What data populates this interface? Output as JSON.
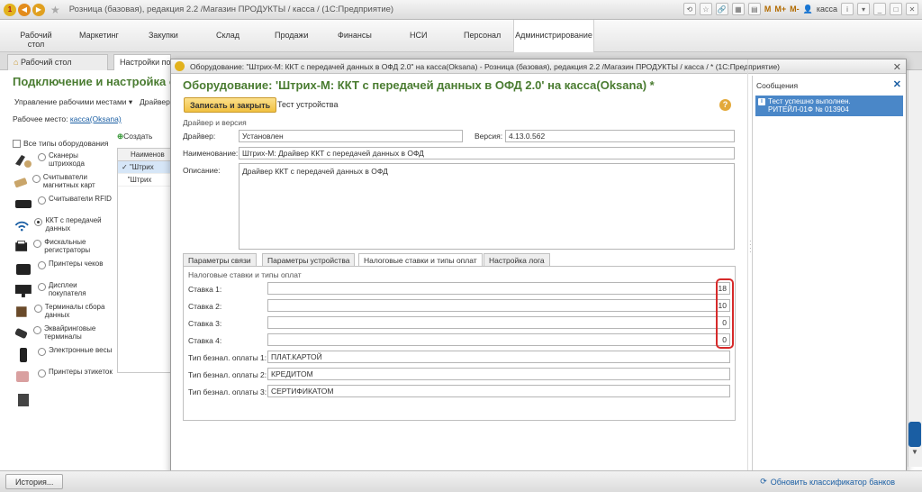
{
  "window": {
    "title": "Розница (базовая), редакция 2.2 /Магазин ПРОДУКТЫ / касса /  (1С:Предприятие)",
    "user": "касса",
    "m_buttons": [
      "M",
      "M+",
      "M-"
    ]
  },
  "sections": [
    "Рабочий стол",
    "Маркетинг",
    "Закупки",
    "Склад",
    "Продажи",
    "Финансы",
    "НСИ",
    "Персонал",
    "Администрирование"
  ],
  "tabs": [
    "Рабочий стол",
    "Настройки под"
  ],
  "page": {
    "title": "Подключение и настройка о",
    "subnav_left": "Управление рабочими местами",
    "subnav_right": "Драйвер",
    "workplace_label": "Рабочее место:",
    "workplace_value": "касса(Oksana)",
    "create_label": "Создать",
    "all_types_label": "Все типы оборудования",
    "device_types": [
      "Сканеры штрихкода",
      "Считыватели магнитных карт",
      "Считыватели RFID",
      "ККТ с передачей данных",
      "Фискальные регистраторы",
      "Принтеры чеков",
      "Дисплеи покупателя",
      "Терминалы сбора данных",
      "Эквайринговые терминалы",
      "Электронные весы",
      "Принтеры этикеток"
    ],
    "grid_header": "Наименов",
    "grid_rows": [
      "\"Штрих",
      "\"Штрих"
    ]
  },
  "modal": {
    "window_title": "Оборудование: \"Штрих-М: ККТ с передачей данных в ОФД 2.0\" на касса(Oksana) - Розница (базовая), редакция 2.2 /Магазин ПРОДУКТЫ / касса / * (1С:Предприятие)",
    "form_title": "Оборудование: 'Штрих-М: ККТ с передачей данных в ОФД 2.0' на касса(Oksana) *",
    "save_close": "Записать и закрыть",
    "test_device": "Тест устройства",
    "help": "?",
    "group_title": "Драйвер и версия",
    "driver_label": "Драйвер:",
    "driver_value": "Установлен",
    "version_label": "Версия:",
    "version_value": "4.13.0.562",
    "name_label": "Наименование:",
    "name_value": "Штрих-М: Драйвер ККТ с передачей данных в ОФД",
    "desc_label": "Описание:",
    "desc_value": "Драйвер ККТ с передачей данных в ОФД",
    "inner_tabs": [
      "Параметры связи",
      "Параметры устройства",
      "Налоговые ставки и типы оплат",
      "Настройка лога"
    ],
    "tax_group_title": "Налоговые ставки и типы оплат",
    "rates": [
      {
        "label": "Ставка 1:",
        "value": "18"
      },
      {
        "label": "Ставка 2:",
        "value": "10"
      },
      {
        "label": "Ставка 3:",
        "value": "0"
      },
      {
        "label": "Ставка 4:",
        "value": "0"
      }
    ],
    "payments": [
      {
        "label": "Тип безнал. оплаты 1:",
        "value": "ПЛАТ.КАРТОЙ"
      },
      {
        "label": "Тип безнал. оплаты 2:",
        "value": "КРЕДИТОМ"
      },
      {
        "label": "Тип безнал. оплаты 3:",
        "value": "СЕРТИФИКАТОМ"
      }
    ]
  },
  "messages": {
    "title": "Сообщения",
    "items": [
      "Тест успешно выполнен.",
      "РИТЕЙЛ-01Ф № 013904"
    ]
  },
  "statusbar": {
    "history": "История...",
    "update_link": "Обновить классификатор банков"
  },
  "colors": {
    "title_green": "#4a7c31",
    "highlight_red": "#d62a2a",
    "message_blue": "#4a87c8",
    "button_yellow": "#f1c141"
  }
}
